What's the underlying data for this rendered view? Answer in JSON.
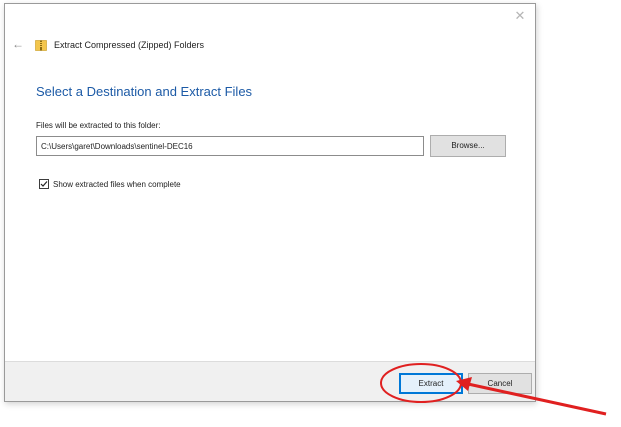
{
  "window": {
    "title": "Extract Compressed (Zipped) Folders",
    "close_icon": "✕",
    "back_icon": "←",
    "folder_icon": "zip-folder-icon"
  },
  "page": {
    "heading": "Select a Destination and Extract Files",
    "destination_label": "Files will be extracted to this folder:",
    "destination_value": "C:\\Users\\garet\\Downloads\\sentinel-DEC16",
    "browse_label": "Browse...",
    "show_files_label": "Show extracted files when complete",
    "show_files_checked": true
  },
  "footer": {
    "extract_label": "Extract",
    "cancel_label": "Cancel"
  },
  "annotation": {
    "color": "#e02020",
    "shapes": [
      "ellipse-around-extract-button",
      "arrow-pointing-to-extract-button"
    ]
  },
  "colors": {
    "accent": "#0078d7",
    "heading": "#1c5aa6"
  }
}
